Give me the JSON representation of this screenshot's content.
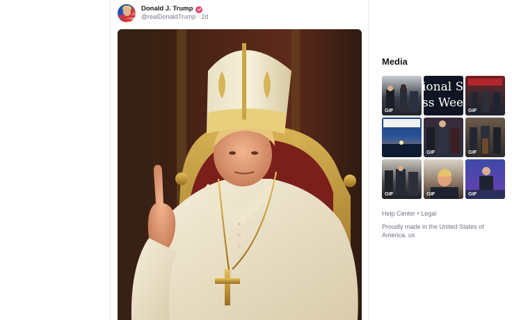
{
  "post": {
    "display_name": "Donald J. Trump",
    "handle": "@realDonaldTrump",
    "separator": "·",
    "age": "2d",
    "verified_color": "#e24a6a"
  },
  "sidebar": {
    "media_title": "Media",
    "thumbnails": [
      {
        "badge": "GIF",
        "caption": ""
      },
      {
        "badge": "",
        "caption": "ional Sm\nss Week"
      },
      {
        "badge": "GIF",
        "caption": ""
      },
      {
        "badge": "",
        "caption": ""
      },
      {
        "badge": "GIF",
        "caption": ""
      },
      {
        "badge": "GIF",
        "caption": ""
      },
      {
        "badge": "GIF",
        "caption": ""
      },
      {
        "badge": "GIF",
        "caption": ""
      },
      {
        "badge": "GIF",
        "caption": ""
      }
    ],
    "footer": {
      "help_center": "Help Center",
      "bullet": "•",
      "legal": "Legal",
      "made_in": "Proudly made in the United States of America. us"
    }
  }
}
